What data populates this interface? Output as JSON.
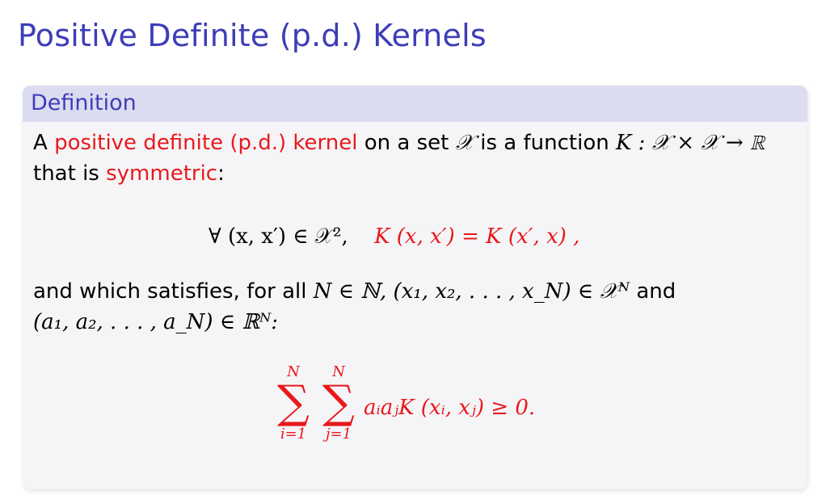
{
  "slide": {
    "title": "Positive Definite (p.d.) Kernels"
  },
  "block": {
    "title": "Definition",
    "line1": {
      "prefix": "A ",
      "highlight": "positive definite (p.d.) kernel",
      "mid": " on a set ",
      "set_symbol": "𝒳",
      "after": " is a function ",
      "math": "K : 𝒳 × 𝒳 → ℝ"
    },
    "line2": {
      "prefix": "that is ",
      "highlight": "symmetric",
      "suffix": ":"
    },
    "eq1": {
      "left": "∀ (x, x′) ∈ 𝒳², ",
      "right": "K (x, x′) = K (x′, x) ,"
    },
    "line3": {
      "text": "and which satisfies, for all ",
      "math1": "N ∈ ℕ, (x₁, x₂, . . . , x_N) ∈ 𝒳ᴺ",
      "suffix": " and"
    },
    "line4": {
      "math": "(a₁, a₂, . . . , a_N) ∈ ℝᴺ:"
    },
    "eq2": {
      "sum_symbol": "∑",
      "upper": "N",
      "lower_i": "i=1",
      "lower_j": "j=1",
      "body": "aᵢaⱼK (xᵢ, xⱼ) ≥ 0."
    }
  }
}
